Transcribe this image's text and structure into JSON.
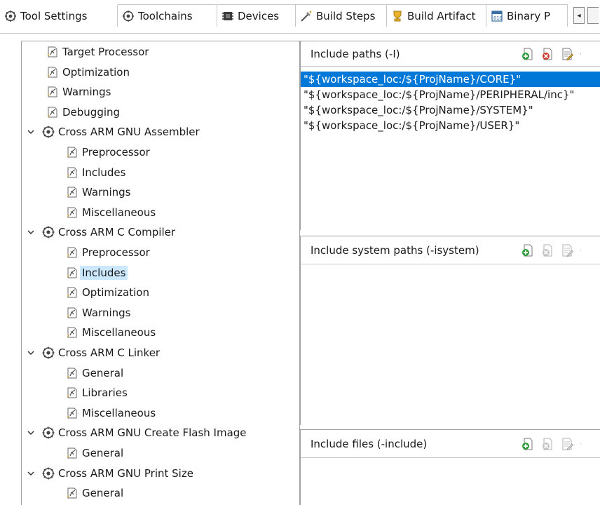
{
  "tabs": [
    {
      "label": "Tool Settings",
      "icon": "tool-settings-icon",
      "active": true
    },
    {
      "label": "Toolchains",
      "icon": "toolchains-icon"
    },
    {
      "label": "Devices",
      "icon": "devices-icon"
    },
    {
      "label": "Build Steps",
      "icon": "build-steps-icon"
    },
    {
      "label": "Build Artifact",
      "icon": "build-artifact-icon"
    },
    {
      "label": "Binary P",
      "icon": "binary-icon"
    }
  ],
  "tab_scroll": {
    "left": "◂"
  },
  "tree": [
    {
      "label": "Target Processor"
    },
    {
      "label": "Optimization"
    },
    {
      "label": "Warnings"
    },
    {
      "label": "Debugging"
    },
    {
      "label": "Cross ARM GNU Assembler",
      "expanded": true
    },
    {
      "label": "Preprocessor"
    },
    {
      "label": "Includes"
    },
    {
      "label": "Warnings"
    },
    {
      "label": "Miscellaneous"
    },
    {
      "label": "Cross ARM C Compiler",
      "expanded": true
    },
    {
      "label": "Preprocessor"
    },
    {
      "label": "Includes",
      "selected": true
    },
    {
      "label": "Optimization"
    },
    {
      "label": "Warnings"
    },
    {
      "label": "Miscellaneous"
    },
    {
      "label": "Cross ARM C Linker",
      "expanded": true
    },
    {
      "label": "General"
    },
    {
      "label": "Libraries"
    },
    {
      "label": "Miscellaneous"
    },
    {
      "label": "Cross ARM GNU Create Flash Image",
      "expanded": true
    },
    {
      "label": "General"
    },
    {
      "label": "Cross ARM GNU Print Size",
      "expanded": true
    },
    {
      "label": "General"
    }
  ],
  "include_paths": {
    "title": "Include paths (-I)",
    "items": [
      "\"${workspace_loc:/${ProjName}/CORE}\"",
      "\"${workspace_loc:/${ProjName}/PERIPHERAL/inc}\"",
      "\"${workspace_loc:/${ProjName}/SYSTEM}\"",
      "\"${workspace_loc:/${ProjName}/USER}\""
    ]
  },
  "include_system_paths": {
    "title": "Include system paths (-isystem)"
  },
  "include_files": {
    "title": "Include files (-include)"
  },
  "colors": {
    "selection": "#0078d7",
    "tree_selection": "#cce8ff",
    "add": "#2e9a3a",
    "delete": "#d23a2a"
  }
}
